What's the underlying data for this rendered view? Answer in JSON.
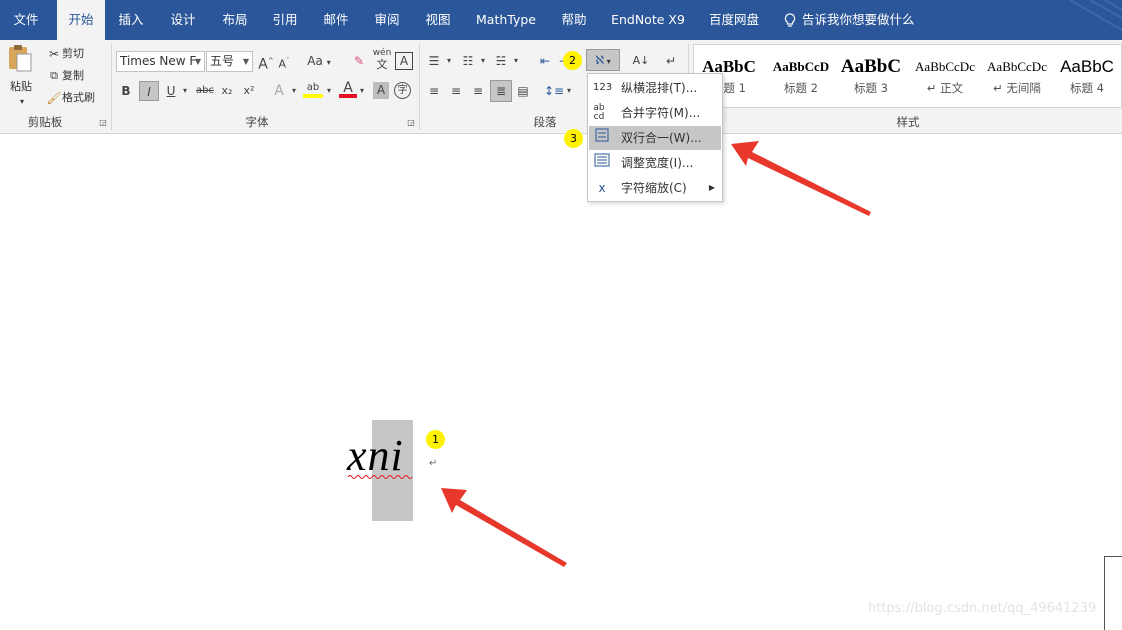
{
  "tabs": [
    {
      "id": "file",
      "label": "文件"
    },
    {
      "id": "home",
      "label": "开始",
      "active": true
    },
    {
      "id": "insert",
      "label": "插入"
    },
    {
      "id": "design",
      "label": "设计"
    },
    {
      "id": "layout",
      "label": "布局"
    },
    {
      "id": "references",
      "label": "引用"
    },
    {
      "id": "mailings",
      "label": "邮件"
    },
    {
      "id": "review",
      "label": "审阅"
    },
    {
      "id": "view",
      "label": "视图"
    },
    {
      "id": "mathtype",
      "label": "MathType"
    },
    {
      "id": "help",
      "label": "帮助"
    },
    {
      "id": "endnote",
      "label": "EndNote X9"
    },
    {
      "id": "baidu",
      "label": "百度网盘"
    }
  ],
  "tellme": {
    "label": "告诉我你想要做什么"
  },
  "clipboard": {
    "paste": "粘贴",
    "cut": "剪切",
    "copy": "复制",
    "format_painter": "格式刷",
    "group_label": "剪贴板"
  },
  "font": {
    "name": "Times New F",
    "size": "五号",
    "group_label": "字体",
    "aa_label": "Aa",
    "grow": "A",
    "shrink": "A",
    "pinyin_top": "wén",
    "pinyin_bottom": "文",
    "border_char": "A",
    "bold": "B",
    "italic": "I",
    "underline": "U",
    "strike": "abc",
    "sub": "x₂",
    "sup": "x²",
    "effects": "A",
    "highlight": "ab",
    "font_color": "A",
    "shade": "A",
    "enclose": "字"
  },
  "paragraph": {
    "group_label": "段落"
  },
  "styles": {
    "group_label": "样式",
    "items": [
      {
        "preview": "AaBbC",
        "name": "标题 1"
      },
      {
        "preview": "AaBbCcD",
        "name": "标题 2"
      },
      {
        "preview": "AaBbC",
        "name": "标题 3"
      },
      {
        "preview": "AaBbCcDc",
        "name": "↵ 正文"
      },
      {
        "preview": "AaBbCcDc",
        "name": "↵ 无间隔"
      },
      {
        "preview": "AaBbC",
        "name": "标题 4"
      }
    ]
  },
  "menu": {
    "items": [
      {
        "icon": "123",
        "label": "纵横混排(T)..."
      },
      {
        "icon": "ab cd",
        "label": "合并字符(M)..."
      },
      {
        "icon": "",
        "label": "双行合一(W)...",
        "highlighted": true
      },
      {
        "icon": "",
        "label": "调整宽度(I)..."
      },
      {
        "icon": "",
        "label": "字符缩放(C)",
        "submenu": true
      }
    ]
  },
  "annotations": {
    "badges": [
      "1",
      "2",
      "3"
    ],
    "arrow_color": "#e8382b"
  },
  "document": {
    "text": "xni",
    "para_mark": "↵"
  },
  "watermark": "https://blog.csdn.net/qq_49641239",
  "colors": {
    "tabbar": "#2b579a",
    "ribbon": "#f3f3f3",
    "highlight": "#c6c6c6",
    "badge": "#fff200",
    "font_color_bar": "#e81123",
    "highlight_bar": "#ffff00"
  }
}
